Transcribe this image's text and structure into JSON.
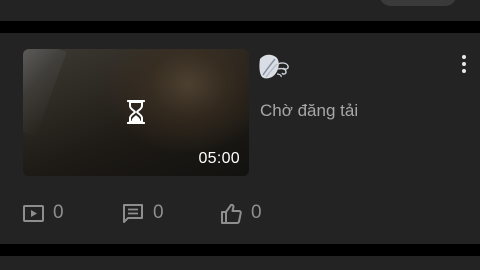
{
  "video_item": {
    "duration": "05:00",
    "status_text": "Chờ đăng tải",
    "stats": {
      "views": "0",
      "comments": "0",
      "likes": "0"
    }
  },
  "icons": {
    "thumbnail_status": "hourglass-icon",
    "channel": "channel-logo",
    "menu": "more-vertical-icon",
    "views": "play-box-icon",
    "comments": "comment-icon",
    "likes": "thumbs-up-icon"
  },
  "colors": {
    "background": "#000000",
    "card": "#232323",
    "status_text": "#a7a7a7",
    "stat_text": "#8e8e8e"
  }
}
